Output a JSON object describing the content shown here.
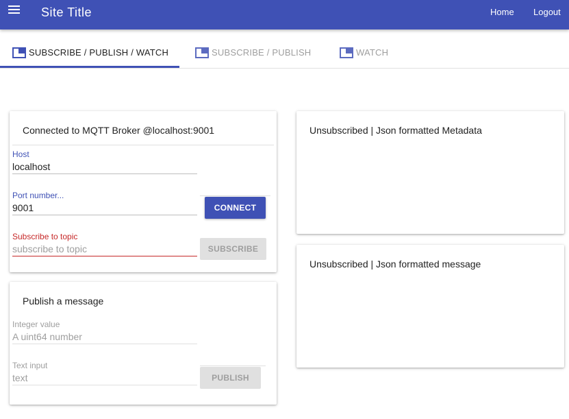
{
  "appbar": {
    "title": "Site Title",
    "nav": {
      "home": "Home",
      "logout": "Logout"
    },
    "bg_color": "#3f51b5"
  },
  "tabs": [
    {
      "label": "SUBSCRIBE / PUBLISH / WATCH",
      "active": true
    },
    {
      "label": "SUBSCRIBE / PUBLISH",
      "active": false
    },
    {
      "label": "WATCH",
      "active": false
    }
  ],
  "connect_card": {
    "title": "Connected to MQTT Broker @localhost:9001",
    "host": {
      "label": "Host",
      "value": "localhost"
    },
    "port": {
      "label": "Port number...",
      "value": "9001"
    },
    "connect_label": "CONNECT",
    "topic": {
      "label": "Subscribe to topic",
      "placeholder": "subscribe to topic"
    },
    "subscribe_label": "SUBSCRIBE"
  },
  "publish_card": {
    "title": "Publish a message",
    "integer": {
      "label": "Integer value",
      "placeholder": "A uint64 number"
    },
    "text": {
      "label": "Text input",
      "placeholder": "text"
    },
    "publish_label": "PUBLISH"
  },
  "metadata_card": {
    "title": "Unsubscribed | Json formatted Metadata"
  },
  "message_card": {
    "title": "Unsubscribed | Json formatted message"
  }
}
